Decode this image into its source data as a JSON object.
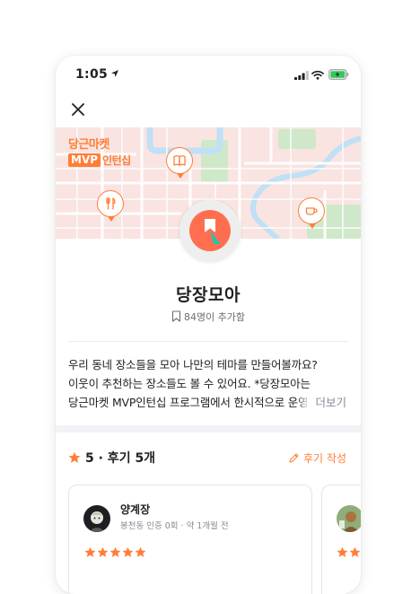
{
  "status_bar": {
    "time": "1:05"
  },
  "header": {
    "close_label": "close"
  },
  "map": {
    "brand_line1": "당근마켓",
    "brand_mvp": "MVP",
    "brand_intern": "인턴십",
    "pins": [
      "book-icon",
      "fork-knife-icon",
      "coffee-icon"
    ]
  },
  "theme": {
    "title": "당장모아",
    "adds_count": "84명이 추가함"
  },
  "description": {
    "lines": [
      "우리 동네 장소들을 모아 나만의 테마를 만들어볼까요?",
      "이웃이 추천하는 장소들도  볼 수 있어요.  *당장모아는",
      "당근마켓 MVP인턴십 프로그램에서 한시적으로 운영"
    ],
    "more_label": "더보기"
  },
  "reviews_section": {
    "rating_label": "5 · 후기 5개",
    "write_label": "후기 작성"
  },
  "reviews": [
    {
      "name": "양계장",
      "meta": "봉천동 인증 0회 · 약 1개월 전",
      "stars": 5
    }
  ],
  "colors": {
    "accent": "#ff7e36",
    "map_bg": "#f9e4e2",
    "water": "#bfe0f6",
    "park": "#cfe8c9"
  }
}
